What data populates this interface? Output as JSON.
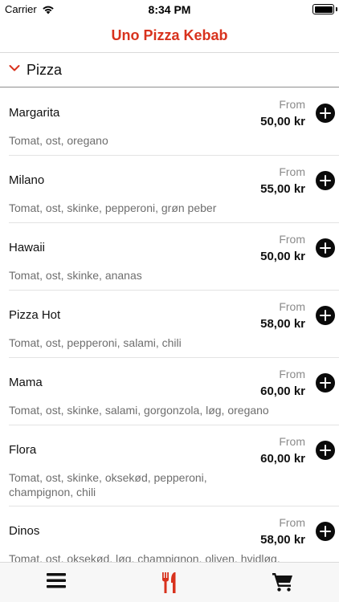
{
  "status_bar": {
    "carrier": "Carrier",
    "time": "8:34 PM"
  },
  "nav": {
    "title": "Uno Pizza Kebab"
  },
  "section": {
    "title": "Pizza"
  },
  "colors": {
    "accent": "#d8321d",
    "add_button": "#0a0a0a"
  },
  "items": [
    {
      "name": "Margarita",
      "from": "From",
      "price": "50,00 kr",
      "description": "Tomat, ost, oregano"
    },
    {
      "name": "Milano",
      "from": "From",
      "price": "55,00 kr",
      "description": "Tomat, ost, skinke, pepperoni, grøn peber"
    },
    {
      "name": "Hawaii",
      "from": "From",
      "price": "50,00 kr",
      "description": "Tomat, ost, skinke, ananas"
    },
    {
      "name": "Pizza Hot",
      "from": "From",
      "price": "58,00 kr",
      "description": "Tomat, ost, pepperoni, salami, chili"
    },
    {
      "name": "Mama",
      "from": "From",
      "price": "60,00 kr",
      "description": "Tomat, ost, skinke, salami, gorgonzola, løg, oregano"
    },
    {
      "name": "Flora",
      "from": "From",
      "price": "60,00 kr",
      "description": "Tomat, ost, skinke, oksekød, pepperoni, champignon, chili"
    },
    {
      "name": "Dinos",
      "from": "From",
      "price": "58,00 kr",
      "description": "Tomat, ost, oksekød, løg, champignon, oliven, hvidløg,"
    }
  ],
  "tabs": [
    {
      "icon": "menu-icon"
    },
    {
      "icon": "fork-knife-icon"
    },
    {
      "icon": "cart-icon"
    }
  ]
}
